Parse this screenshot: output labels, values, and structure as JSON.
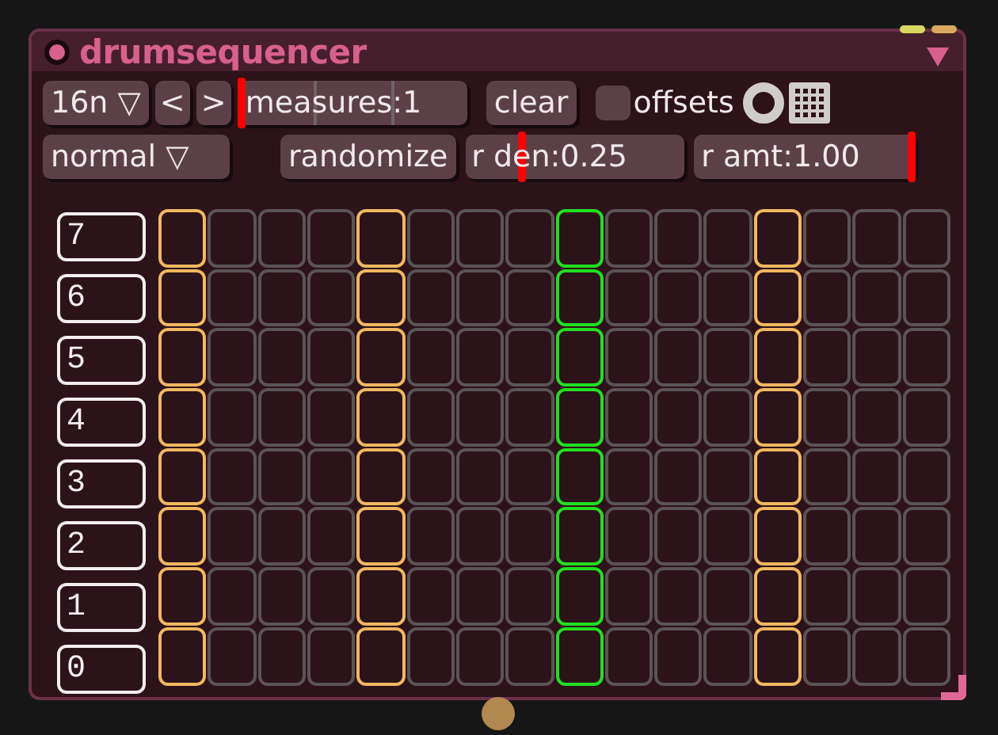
{
  "node": {
    "title": "drumsequencer",
    "collapsed": false
  },
  "toolbar": {
    "division": "16n ▽",
    "prev": "<",
    "next": ">",
    "measures": {
      "label": "measures:1",
      "level": 0.0
    },
    "clear": "clear",
    "offsets": {
      "label": "offsets",
      "checked": false
    }
  },
  "row2": {
    "mode": "normal  ▽",
    "randomize": "randomize",
    "density": {
      "label": "r den:0.25",
      "level": 0.25
    },
    "amount": {
      "label": "r amt:1.00",
      "level": 1.0
    }
  },
  "rows": [
    {
      "label": "7"
    },
    {
      "label": "6"
    },
    {
      "label": "5"
    },
    {
      "label": "4"
    },
    {
      "label": "3"
    },
    {
      "label": "2"
    },
    {
      "label": "1"
    },
    {
      "label": "0"
    }
  ],
  "steps": [
    {
      "kind": "beat"
    },
    {
      "kind": "plain"
    },
    {
      "kind": "plain"
    },
    {
      "kind": "plain"
    },
    {
      "kind": "beat"
    },
    {
      "kind": "plain"
    },
    {
      "kind": "plain"
    },
    {
      "kind": "plain"
    },
    {
      "kind": "playhead"
    },
    {
      "kind": "plain"
    },
    {
      "kind": "plain"
    },
    {
      "kind": "plain"
    },
    {
      "kind": "beat"
    },
    {
      "kind": "plain"
    },
    {
      "kind": "plain"
    },
    {
      "kind": "plain"
    }
  ]
}
